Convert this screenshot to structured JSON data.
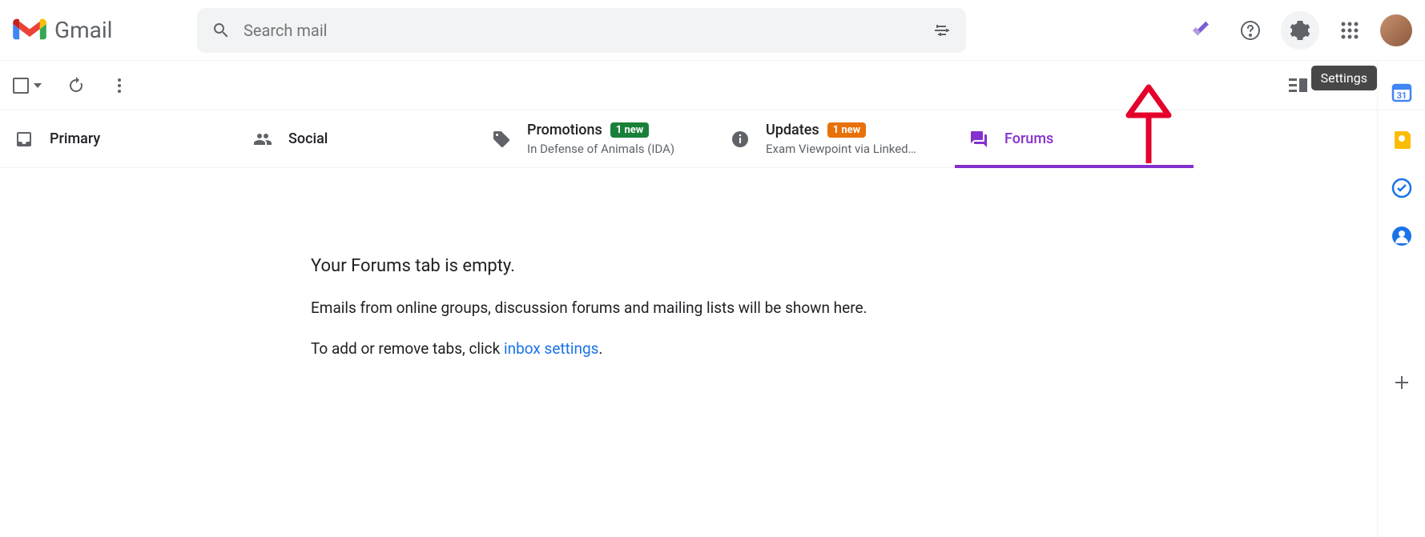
{
  "app": {
    "name": "Gmail"
  },
  "search": {
    "placeholder": "Search mail"
  },
  "tooltip": {
    "settings": "Settings"
  },
  "tabs": {
    "primary": {
      "label": "Primary"
    },
    "social": {
      "label": "Social"
    },
    "promotions": {
      "label": "Promotions",
      "badge": "1 new",
      "sub": "In Defense of Animals (IDA)"
    },
    "updates": {
      "label": "Updates",
      "badge": "1 new",
      "sub": "Exam Viewpoint via Linked…"
    },
    "forums": {
      "label": "Forums"
    }
  },
  "empty": {
    "title": "Your Forums tab is empty.",
    "desc": "Emails from online groups, discussion forums and mailing lists will be shown here.",
    "action_prefix": "To add or remove tabs, click ",
    "action_link": "inbox settings",
    "action_suffix": "."
  }
}
